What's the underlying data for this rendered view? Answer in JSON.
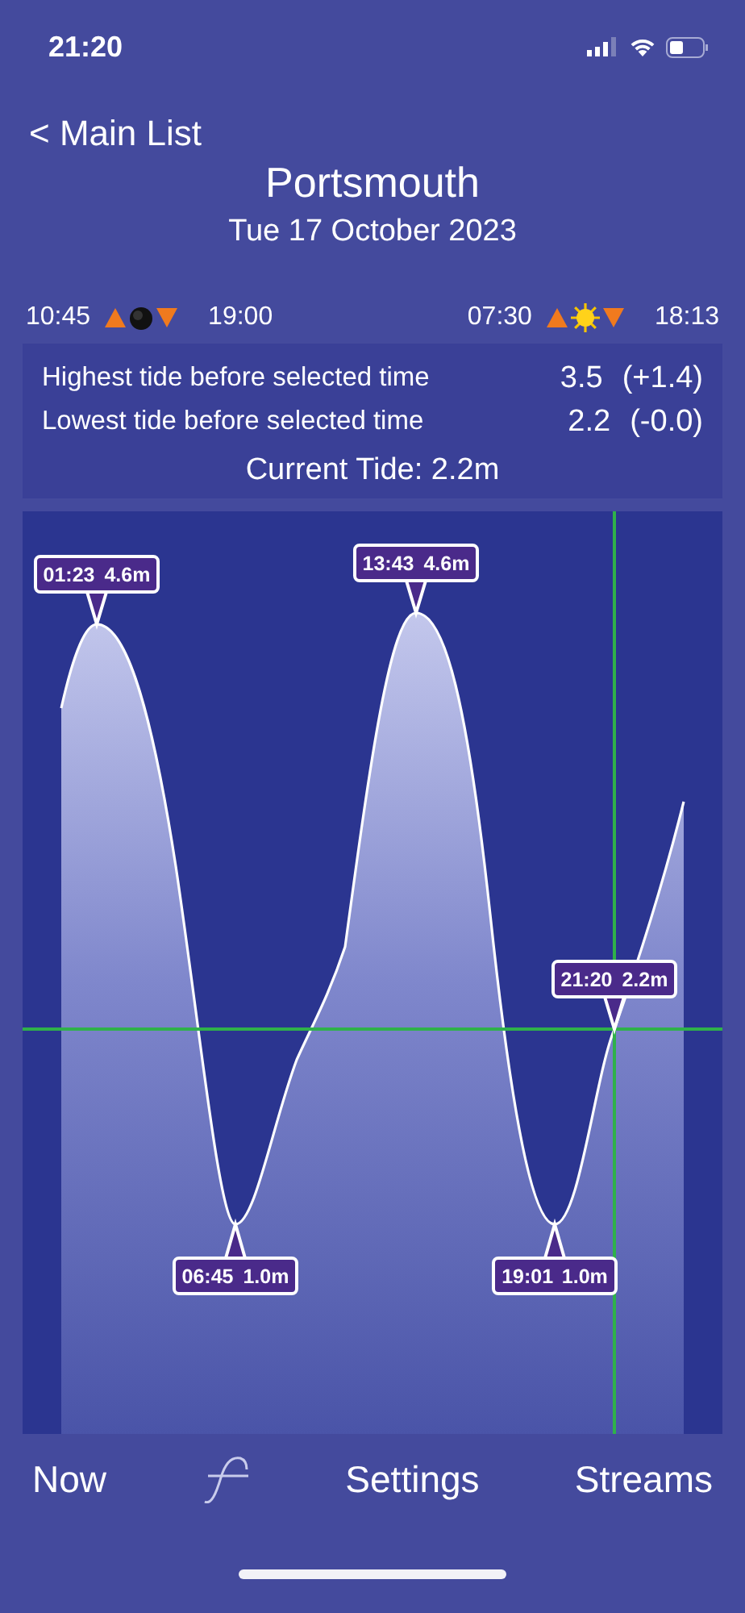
{
  "status_bar": {
    "time": "21:20"
  },
  "nav": {
    "back": "< Main List"
  },
  "header": {
    "location": "Portsmouth",
    "date": "Tue 17 October 2023"
  },
  "moon": {
    "rise": "10:45",
    "set": "19:00"
  },
  "sun": {
    "rise": "07:30",
    "set": "18:13"
  },
  "summary": {
    "rows": [
      {
        "label": "Highest tide before selected time",
        "value": "3.5",
        "change": "(+1.4)"
      },
      {
        "label": "Lowest tide before selected time",
        "value": "2.2",
        "change": "(-0.0)"
      }
    ],
    "current": "Current Tide: 2.2m"
  },
  "chart": {
    "callouts": [
      {
        "kind": "high",
        "time": "01:23",
        "height": "4.6m"
      },
      {
        "kind": "high",
        "time": "13:43",
        "height": "4.6m"
      },
      {
        "kind": "low",
        "time": "06:45",
        "height": "1.0m"
      },
      {
        "kind": "low",
        "time": "19:01",
        "height": "1.0m"
      },
      {
        "kind": "current",
        "time": "21:20",
        "height": "2.2m"
      }
    ]
  },
  "tab_bar": {
    "items": [
      {
        "kind": "text",
        "label": "Now"
      },
      {
        "kind": "icon"
      },
      {
        "kind": "text",
        "label": "Settings"
      },
      {
        "kind": "text",
        "label": "Streams"
      }
    ]
  }
}
